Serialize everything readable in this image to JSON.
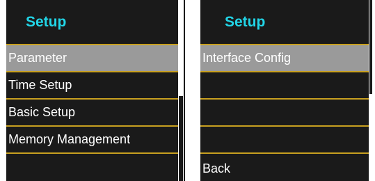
{
  "left_menu": {
    "title": "Setup",
    "items": [
      {
        "label": "Parameter",
        "selected": true
      },
      {
        "label": "Time Setup",
        "selected": false
      },
      {
        "label": "Basic Setup",
        "selected": false
      },
      {
        "label": "Memory Management",
        "selected": false
      },
      {
        "label": "",
        "selected": false
      }
    ]
  },
  "right_menu": {
    "title": "Setup",
    "items": [
      {
        "label": "Interface Config",
        "selected": true
      },
      {
        "label": "",
        "selected": false
      },
      {
        "label": "",
        "selected": false
      },
      {
        "label": "",
        "selected": false
      },
      {
        "label": "Back",
        "selected": false
      }
    ]
  },
  "colors": {
    "background": "#1a1a1a",
    "title": "#22d6e8",
    "separator": "#c8a020",
    "selected": "#9a9a9a",
    "text": "#ffffff"
  }
}
